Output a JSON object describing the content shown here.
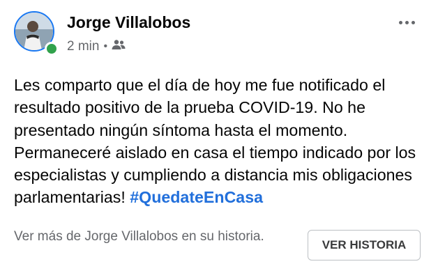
{
  "author": {
    "name": "Jorge Villalobos",
    "online": true
  },
  "meta": {
    "time": "2 min",
    "separator": "•",
    "audience_icon": "friends-icon"
  },
  "post": {
    "text": "Les comparto que el día de hoy me fue notificado el resultado positivo de la prueba COVID-19. No he presentado ningún síntoma hasta el momento. Permaneceré aislado en casa el tiempo indicado por los especialistas y cumpliendo a distancia mis obligaciones parlamentarias! ",
    "hashtag": "#QuedateEnCasa"
  },
  "story": {
    "prompt": "Ver más de Jorge Villalobos en su historia.",
    "button_label": "VER HISTORIA"
  },
  "colors": {
    "hashtag": "#216fdb",
    "online": "#31a24c",
    "avatar_ring": "#1877f2",
    "secondary_text": "#65676b"
  },
  "icons": {
    "more": "more-options-icon"
  }
}
